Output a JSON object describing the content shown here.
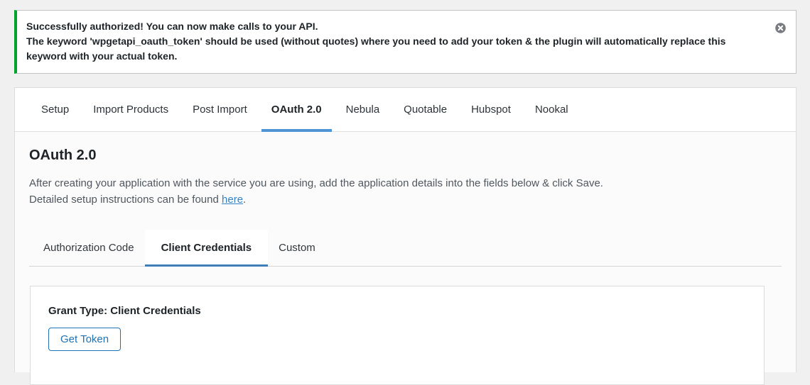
{
  "notice": {
    "line1": "Successfully authorized! You can now make calls to your API.",
    "line2": "The keyword 'wpgetapi_oauth_token' should be used (without quotes) where you need to add your token & the plugin will automatically replace this keyword with your actual token.",
    "dismiss_icon": "circle-x-icon",
    "accent_color": "#00a32a"
  },
  "tabs": {
    "active_underline_color": "#4f94d4",
    "items": [
      {
        "label": "Setup",
        "active": false
      },
      {
        "label": "Import Products",
        "active": false
      },
      {
        "label": "Post Import",
        "active": false
      },
      {
        "label": "OAuth 2.0",
        "active": true
      },
      {
        "label": "Nebula",
        "active": false
      },
      {
        "label": "Quotable",
        "active": false
      },
      {
        "label": "Hubspot",
        "active": false
      },
      {
        "label": "Nookal",
        "active": false
      }
    ]
  },
  "panel": {
    "title": "OAuth 2.0",
    "description_line1": "After creating your application with the service you are using, add the application details into the fields below & click Save.",
    "instructions_prefix": "Detailed setup instructions can be found ",
    "instructions_link": "here",
    "instructions_suffix": ".",
    "subtab_underline_color": "#3e7db6",
    "subtabs": [
      {
        "label": "Authorization Code",
        "active": false
      },
      {
        "label": "Client Credentials",
        "active": true
      },
      {
        "label": "Custom",
        "active": false
      }
    ],
    "grant": {
      "heading": "Grant Type: Client Credentials",
      "button_label": "Get Token",
      "button_color": "#2271b1"
    }
  }
}
